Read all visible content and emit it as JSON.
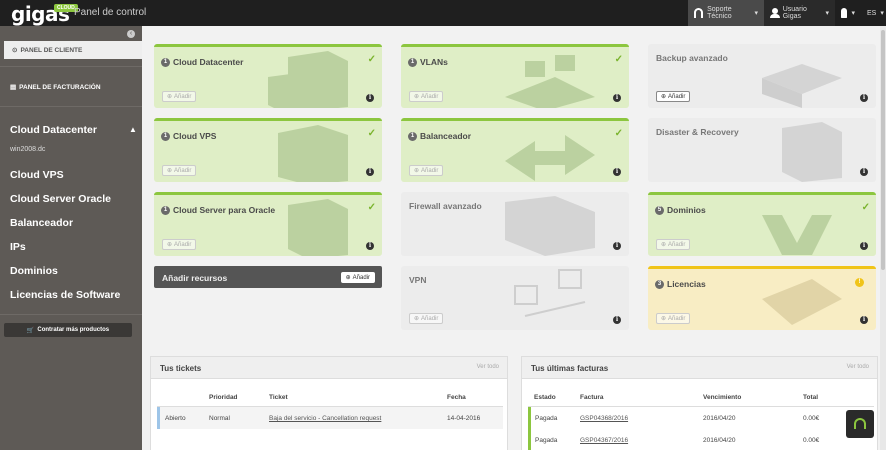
{
  "topbar": {
    "logo": "gigas",
    "logo_badge": "CLOUD",
    "panel_title": "Panel de control",
    "support": "Soporte Técnico",
    "user": "Usuario Gigas",
    "lang": "ES"
  },
  "sidebar": {
    "client_panel": "PANEL DE CLIENTE",
    "billing_panel": "PANEL DE FACTURACIÓN",
    "cloud_datacenter": "Cloud Datacenter",
    "datacenter_sub": "win2008.dc",
    "items": [
      {
        "label": "Cloud VPS"
      },
      {
        "label": "Cloud Server Oracle"
      },
      {
        "label": "Balanceador"
      },
      {
        "label": "IPs"
      },
      {
        "label": "Dominios"
      },
      {
        "label": "Licencias de Software"
      }
    ],
    "buy_button": "Contratar más productos"
  },
  "cards": {
    "cloud_datacenter": {
      "num": "1",
      "title": "Cloud Datacenter",
      "add": "Añadir"
    },
    "vlans": {
      "num": "1",
      "title": "VLANs",
      "add": "Añadir"
    },
    "backup": {
      "title": "Backup avanzado",
      "add": "Añadir"
    },
    "cloud_vps": {
      "num": "1",
      "title": "Cloud VPS",
      "add": "Añadir"
    },
    "balanceador": {
      "num": "1",
      "title": "Balanceador",
      "add": "Añadir"
    },
    "disaster": {
      "title": "Disaster & Recovery"
    },
    "cloud_oracle": {
      "num": "1",
      "title": "Cloud Server para Oracle",
      "add": "Añadir"
    },
    "firewall": {
      "title": "Firewall avanzado"
    },
    "dominios": {
      "num": "5",
      "title": "Dominios",
      "add": "Añadir"
    },
    "add_resources": {
      "title": "Añadir recursos",
      "add": "Añadir"
    },
    "vpn": {
      "title": "VPN",
      "add": "Añadir"
    },
    "licencias": {
      "num": "3",
      "title": "Licencias",
      "add": "Añadir"
    }
  },
  "tickets": {
    "title": "Tus tickets",
    "see_all": "Ver todo",
    "headers": [
      "Prioridad",
      "Ticket",
      "Fecha"
    ],
    "rows": [
      {
        "status": "Abierto",
        "priority": "Normal",
        "ticket": "Baja del servicio - Cancellation request",
        "date": "14-04-2016"
      }
    ]
  },
  "invoices": {
    "title": "Tus últimas facturas",
    "see_all": "Ver todo",
    "headers": [
      "Estado",
      "Factura",
      "Vencimiento",
      "Total"
    ],
    "rows": [
      {
        "status": "Pagada",
        "invoice": "GSP04368/2016",
        "due": "2016/04/20",
        "total": "0.00€"
      },
      {
        "status": "Pagada",
        "invoice": "GSP04367/2016",
        "due": "2016/04/20",
        "total": "0.00€"
      }
    ]
  },
  "colors": {
    "accent_green": "#8cc63f",
    "sidebar": "#5e5a56",
    "topbar": "#1f1f1f",
    "warning": "#f0c419"
  }
}
